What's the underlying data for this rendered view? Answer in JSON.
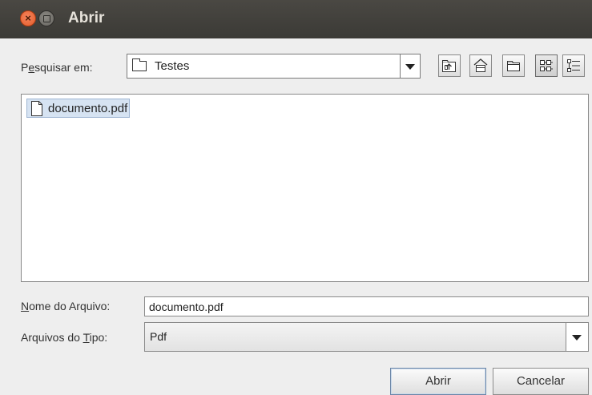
{
  "window": {
    "title": "Abrir",
    "close_glyph": "×"
  },
  "look_in": {
    "label_prefix": "P",
    "label_mnemonic": "e",
    "label_suffix": "squisar em:",
    "current_folder": "Testes",
    "folder_icon": "folder-icon"
  },
  "toolbar": {
    "buttons": [
      {
        "name": "up-one-level-icon"
      },
      {
        "name": "home-icon"
      },
      {
        "name": "new-folder-icon"
      },
      {
        "name": "list-view-icon",
        "active": true
      },
      {
        "name": "details-view-icon"
      }
    ]
  },
  "file_list": {
    "items": [
      {
        "name": "documento.pdf",
        "icon": "file-icon",
        "selected": true
      }
    ]
  },
  "file_name": {
    "label_mnemonic": "N",
    "label_suffix": "ome do Arquivo:",
    "value": "documento.pdf"
  },
  "file_type": {
    "label_prefix": "Arquivos do ",
    "label_mnemonic": "T",
    "label_suffix": "ipo:",
    "selected": "Pdf"
  },
  "buttons": {
    "open": "Abrir",
    "cancel": "Cancelar"
  },
  "colors": {
    "titlebar": "#3b3a36",
    "close_button": "#e35c2a",
    "selection": "#d6e3f2",
    "background": "#eeeeee"
  }
}
